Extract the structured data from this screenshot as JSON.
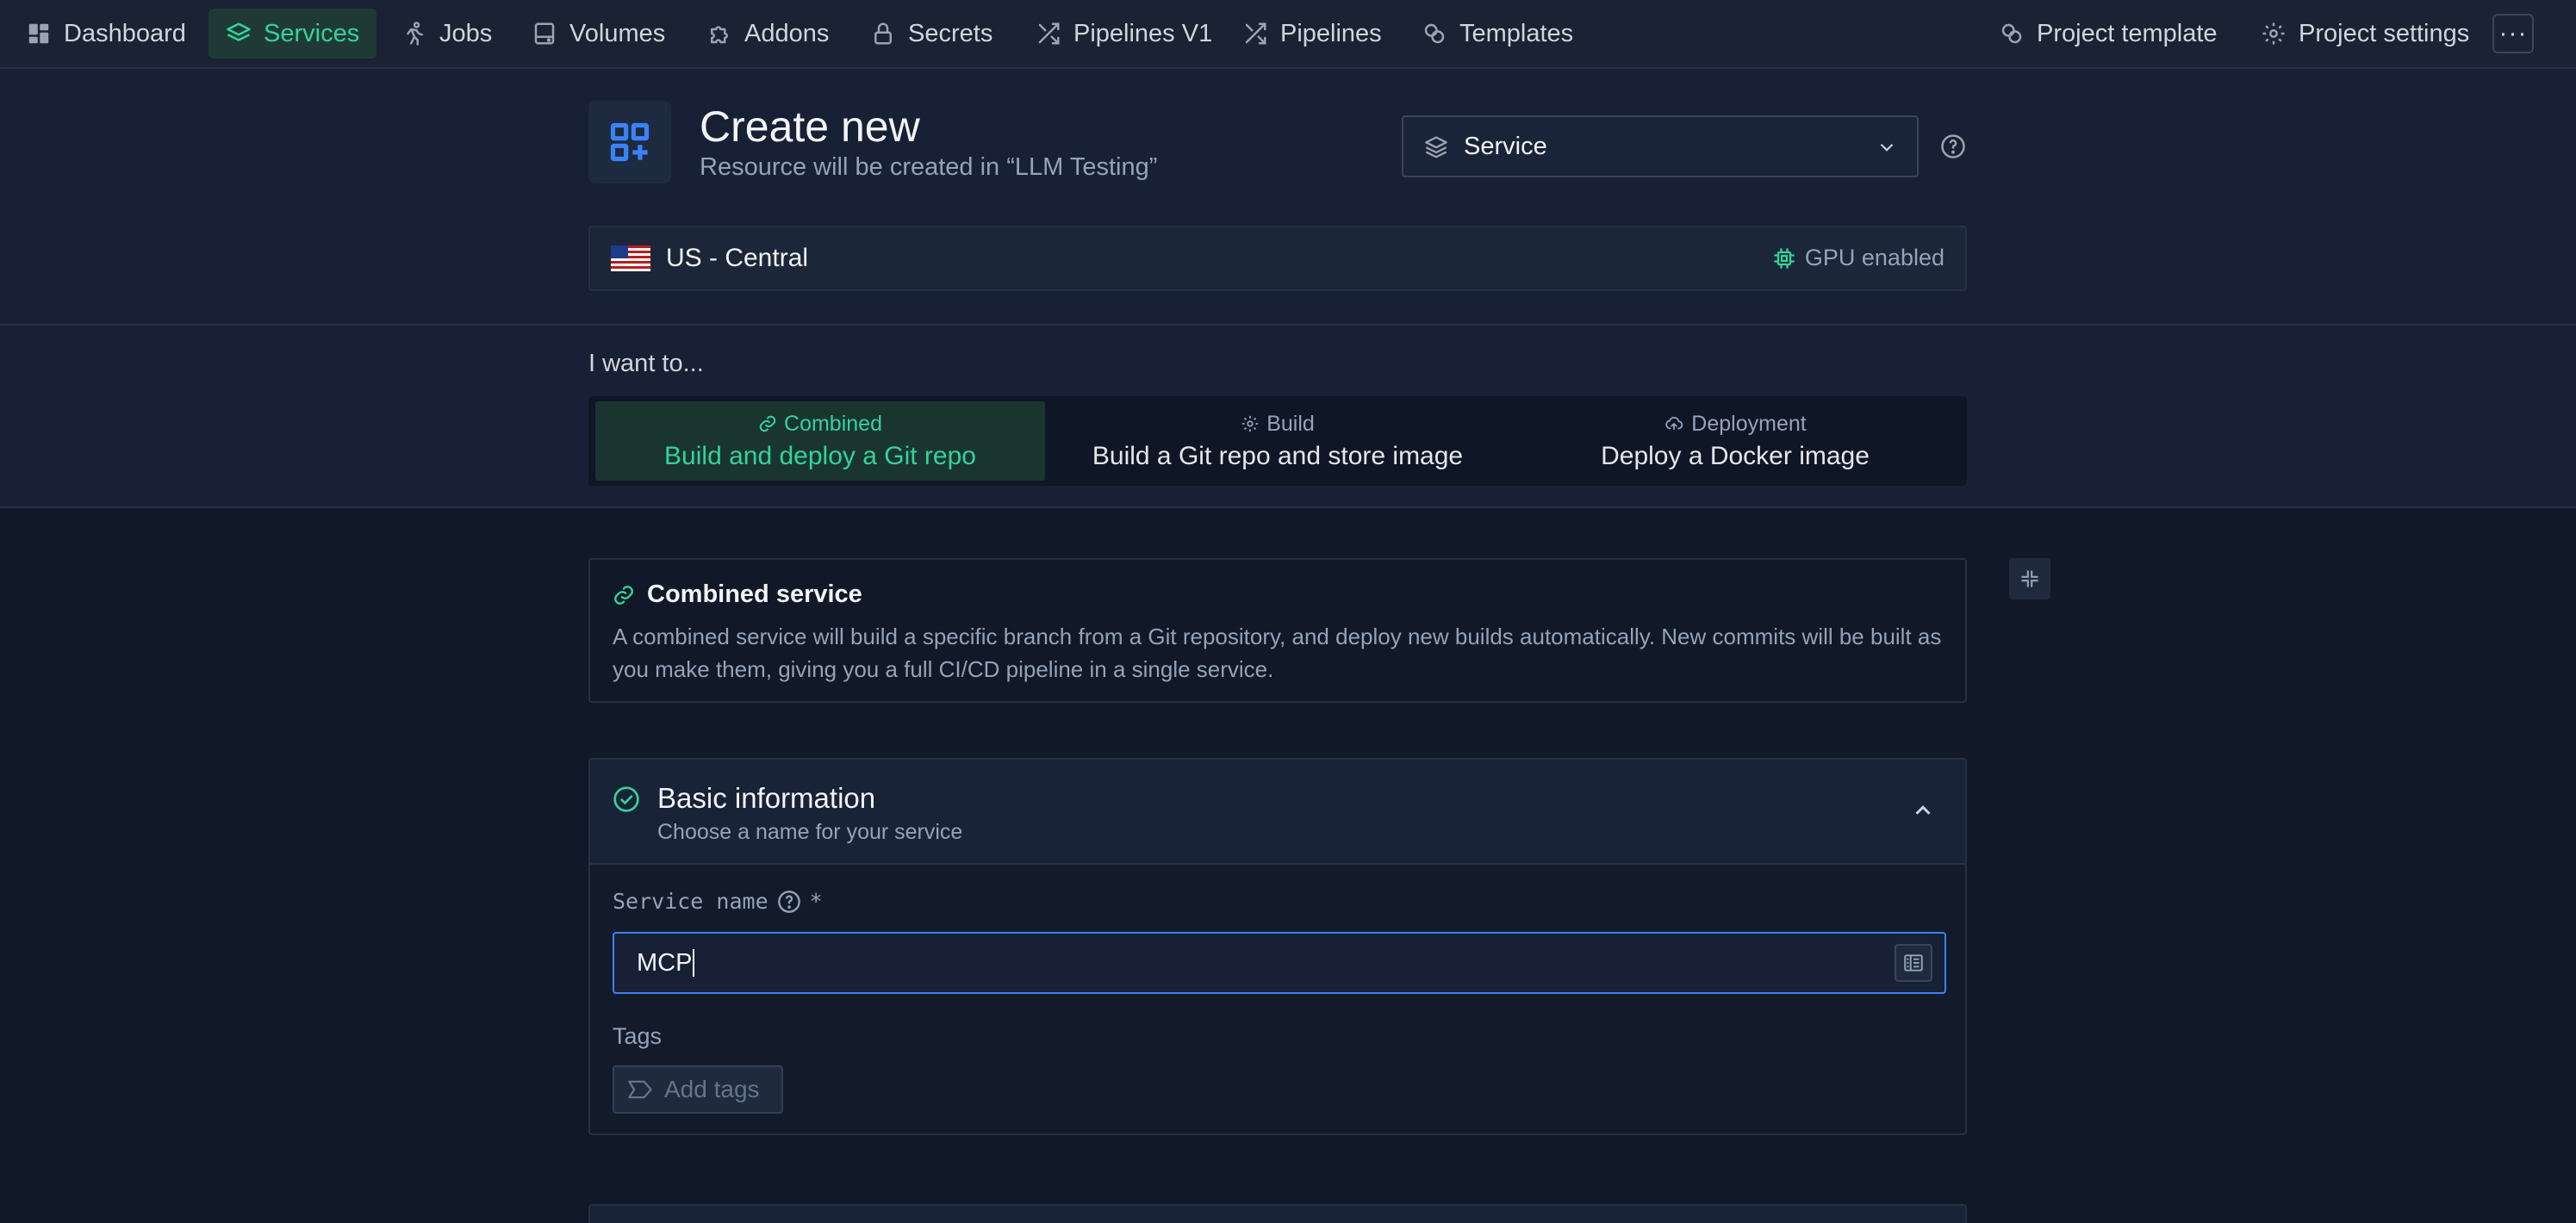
{
  "nav": {
    "items": [
      {
        "label": "Dashboard",
        "icon": "dashboard-icon"
      },
      {
        "label": "Services",
        "icon": "layers-icon",
        "active": true
      },
      {
        "label": "Jobs",
        "icon": "running-icon"
      },
      {
        "label": "Volumes",
        "icon": "hard-drive-icon"
      },
      {
        "label": "Addons",
        "icon": "puzzle-icon"
      },
      {
        "label": "Secrets",
        "icon": "lock-icon"
      },
      {
        "label": "Pipelines V1",
        "icon": "shuffle-icon"
      },
      {
        "label": "Pipelines",
        "icon": "shuffle-icon"
      },
      {
        "label": "Templates",
        "icon": "templates-icon"
      }
    ],
    "right": [
      {
        "label": "Project template",
        "icon": "templates-icon"
      },
      {
        "label": "Project settings",
        "icon": "gear-icon"
      }
    ],
    "more_label": "···"
  },
  "header": {
    "title": "Create new",
    "subtitle": "Resource will be created in “LLM Testing”",
    "resource_type": "Service"
  },
  "region": {
    "name": "US - Central",
    "flag": "us-flag",
    "gpu_label": "GPU enabled"
  },
  "intent": {
    "label": "I want to...",
    "options": [
      {
        "kicker": "Combined",
        "label": "Build and deploy a Git repo",
        "icon": "link-icon",
        "selected": true
      },
      {
        "kicker": "Build",
        "label": "Build a Git repo and store image",
        "icon": "gear-icon",
        "selected": false
      },
      {
        "kicker": "Deployment",
        "label": "Deploy a Docker image",
        "icon": "cloud-upload-icon",
        "selected": false
      }
    ]
  },
  "info": {
    "title": "Combined service",
    "description": "A combined service will build a specific branch from a Git repository, and deploy new builds automatically. New commits will be built as you make them, giving you a full CI/CD pipeline in a single service."
  },
  "basic": {
    "title": "Basic information",
    "subtitle": "Choose a name for your service",
    "service_name_label": "Service name",
    "required_mark": "*",
    "service_name_value": "MCP",
    "tags_label": "Tags",
    "add_tags_label": "Add tags"
  },
  "colors": {
    "accent": "#34d399",
    "focus": "#3b82f6",
    "background": "#111827",
    "brand_icon": "#3b82f6"
  }
}
